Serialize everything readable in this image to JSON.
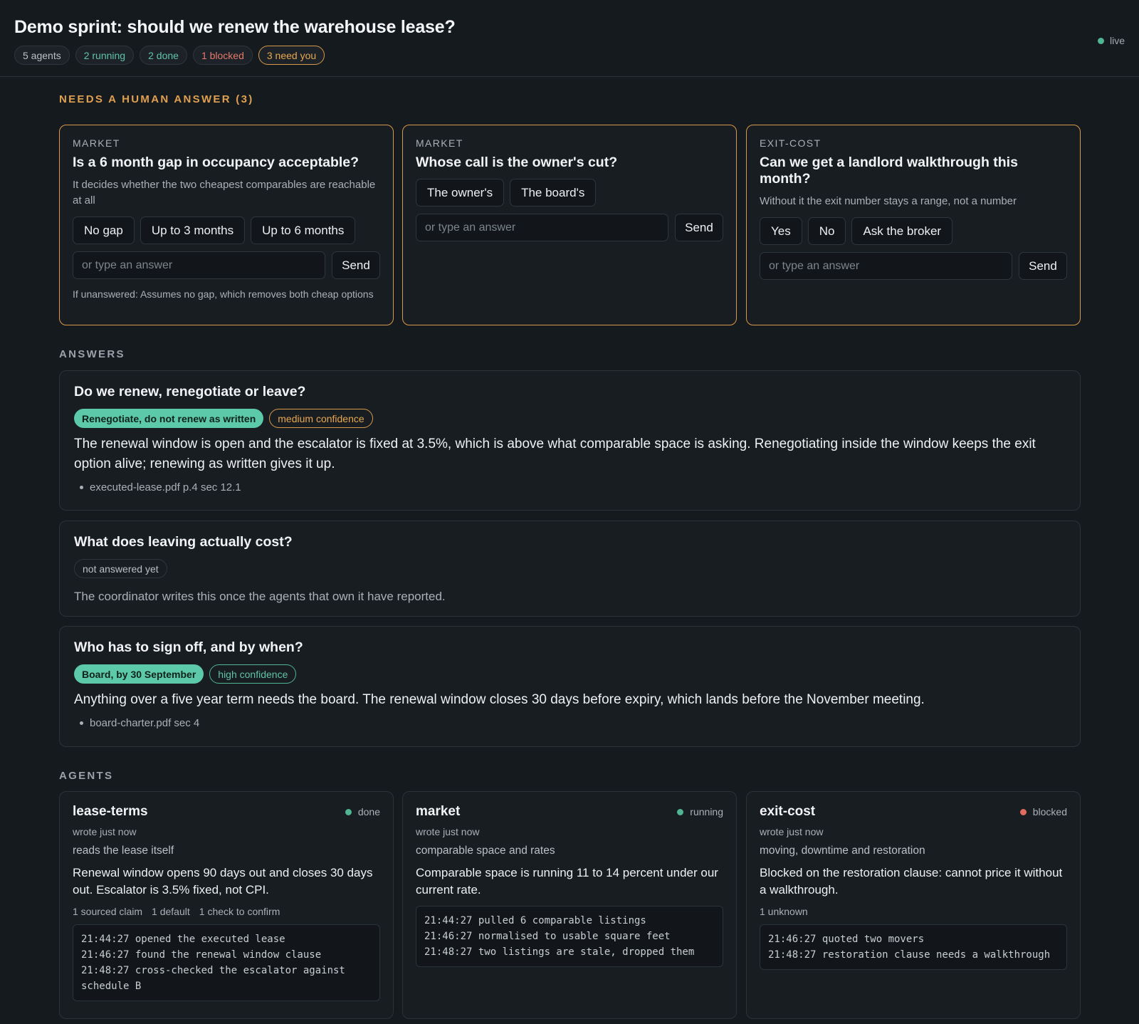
{
  "header": {
    "title": "Demo sprint: should we renew the warehouse lease?",
    "pills": {
      "agents": "5 agents",
      "running": "2 running",
      "done": "2 done",
      "blocked": "1 blocked",
      "need": "3 need you"
    },
    "live": "live"
  },
  "sections": {
    "needs": "NEEDS A HUMAN ANSWER (3)",
    "answers": "ANSWERS",
    "agents": "AGENTS"
  },
  "questions": [
    {
      "category": "MARKET",
      "title": "Is a 6 month gap in occupancy acceptable?",
      "description": "It decides whether the two cheapest comparables are reachable at all",
      "options": [
        "No gap",
        "Up to 3 months",
        "Up to 6 months"
      ],
      "placeholder": "or type an answer",
      "send": "Send",
      "footnote": "If unanswered: Assumes no gap, which removes both cheap options"
    },
    {
      "category": "MARKET",
      "title": "Whose call is the owner's cut?",
      "options": [
        "The owner's",
        "The board's"
      ],
      "placeholder": "or type an answer",
      "send": "Send"
    },
    {
      "category": "EXIT-COST",
      "title": "Can we get a landlord walkthrough this month?",
      "description": "Without it the exit number stays a range, not a number",
      "options": [
        "Yes",
        "No",
        "Ask the broker"
      ],
      "placeholder": "or type an answer",
      "send": "Send"
    }
  ],
  "answers": [
    {
      "title": "Do we renew, renegotiate or leave?",
      "verdict": "Renegotiate, do not renew as written",
      "confidence": "medium confidence",
      "body": "The renewal window is open and the escalator is fixed at 3.5%, which is above what comparable space is asking. Renegotiating inside the window keeps the exit option alive; renewing as written gives it up.",
      "source": "executed-lease.pdf p.4 sec 12.1"
    },
    {
      "title": "What does leaving actually cost?",
      "status": "not answered yet",
      "body": "The coordinator writes this once the agents that own it have reported."
    },
    {
      "title": "Who has to sign off, and by when?",
      "verdict": "Board, by 30 September",
      "confidence": "high confidence",
      "body": "Anything over a five year term needs the board. The renewal window closes 30 days before expiry, which lands before the November meeting.",
      "source": "board-charter.pdf sec 4"
    }
  ],
  "agents": [
    {
      "name": "lease-terms",
      "status": "done",
      "status_color": "#4fb592",
      "meta": "wrote just now",
      "role": "reads the lease itself",
      "summary": "Renewal window opens 90 days out and closes 30 days out. Escalator is 3.5% fixed, not CPI.",
      "tags": [
        "1 sourced claim",
        "1 default",
        "1 check to confirm"
      ],
      "log": [
        "21:44:27 opened the executed lease",
        "21:46:27 found the renewal window clause",
        "21:48:27 cross-checked the escalator against schedule B"
      ]
    },
    {
      "name": "market",
      "status": "running",
      "status_color": "#4fb592",
      "meta": "wrote just now",
      "role": "comparable space and rates",
      "summary": "Comparable space is running 11 to 14 percent under our current rate.",
      "log": [
        "21:44:27 pulled 6 comparable listings",
        "21:46:27 normalised to usable square feet",
        "21:48:27 two listings are stale, dropped them"
      ]
    },
    {
      "name": "exit-cost",
      "status": "blocked",
      "status_color": "#e06b5f",
      "meta": "wrote just now",
      "role": "moving, downtime and restoration",
      "summary": "Blocked on the restoration clause: cannot price it without a walkthrough.",
      "tags": [
        "1 unknown"
      ],
      "log": [
        "21:46:27 quoted two movers",
        "21:48:27 restoration clause needs a walkthrough"
      ]
    }
  ]
}
